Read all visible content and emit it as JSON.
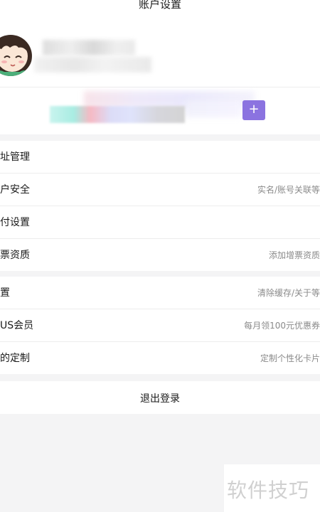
{
  "header": {
    "title": "账户设置"
  },
  "profile": {
    "avatar": "avatar"
  },
  "card": {
    "button_icon": "plus-icon"
  },
  "group1": {
    "rows": [
      {
        "label": "址管理",
        "value": ""
      },
      {
        "label": "户安全",
        "value": "实名/账号关联等"
      },
      {
        "label": "付设置",
        "value": ""
      },
      {
        "label": "票资质",
        "value": "添加增票资质"
      }
    ]
  },
  "group2": {
    "rows": [
      {
        "label": "置",
        "value": "清除缓存/关于等"
      },
      {
        "label": "US会员",
        "value": "每月领100元优惠券"
      },
      {
        "label": "的定制",
        "value": "定制个性化卡片"
      }
    ]
  },
  "logout": {
    "label": "退出登录"
  },
  "watermark": {
    "text": "软件技巧"
  },
  "colors": {
    "accent": "#8b73e0",
    "background": "#f4f4f5"
  }
}
